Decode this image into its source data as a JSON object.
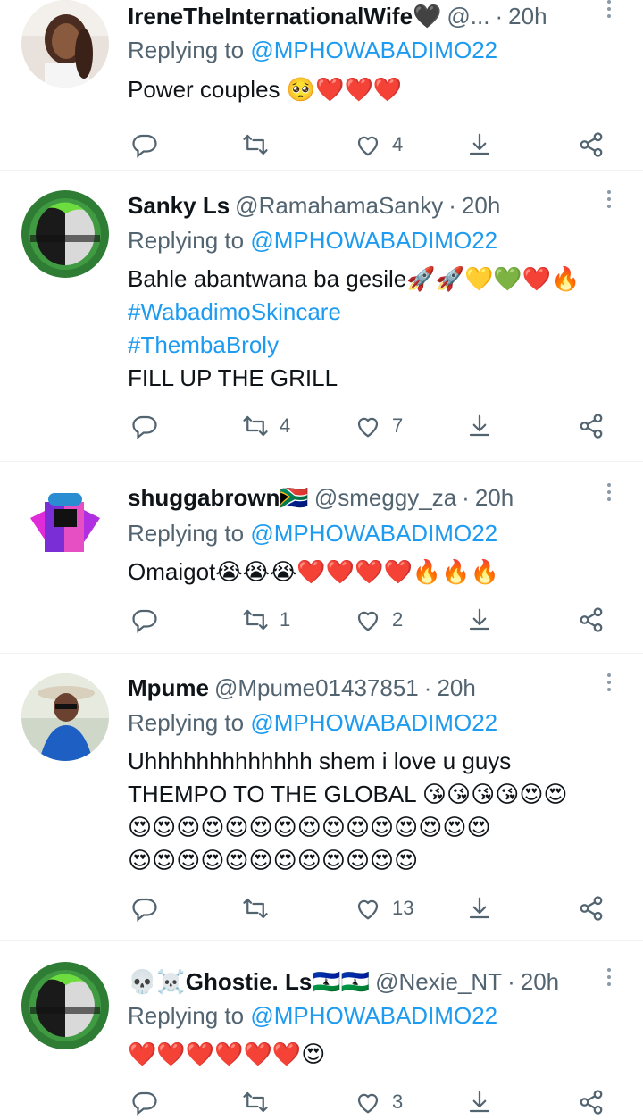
{
  "tweets": [
    {
      "name": "IreneTheInternationalWife🖤",
      "handle": "@...",
      "time": "20h",
      "reply_prefix": "Replying to",
      "reply_to": "@MPHOWABADIMO22",
      "lines": [
        "Power couples 🥺❤️❤️❤️"
      ],
      "stats": {
        "reply": "",
        "retweet": "",
        "like": "4"
      }
    },
    {
      "name": "Sanky Ls",
      "handle": "@RamahamaSanky",
      "time": "20h",
      "reply_prefix": "Replying to",
      "reply_to": "@MPHOWABADIMO22",
      "lines": [
        "Bahle abantwana ba gesile🚀🚀💛💚❤️🔥",
        "#WabadimoSkincare",
        "#ThembaBroly",
        "FILL UP THE GRILL"
      ],
      "stats": {
        "reply": "",
        "retweet": "4",
        "like": "7"
      }
    },
    {
      "name": "shuggabrown🇿🇦",
      "handle": "@smeggy_za",
      "time": "20h",
      "reply_prefix": "Replying to",
      "reply_to": "@MPHOWABADIMO22",
      "lines": [
        "Omaigot😭😭😭❤️❤️❤️❤️🔥🔥🔥"
      ],
      "stats": {
        "reply": "",
        "retweet": "1",
        "like": "2"
      }
    },
    {
      "name": "Mpume",
      "handle": "@Mpume01437851",
      "time": "20h",
      "reply_prefix": "Replying to",
      "reply_to": "@MPHOWABADIMO22",
      "lines": [
        "Uhhhhhhhhhhhhh shem i love u guys",
        "THEMPO TO THE GLOBAL 😘😘😘😘😍😍",
        "😍😍😍😍😍😍😍😍😍😍😍😍😍😍😍",
        "😍😍😍😍😍😍😍😍😍😍😍😍"
      ],
      "stats": {
        "reply": "",
        "retweet": "",
        "like": "13"
      }
    },
    {
      "name": "💀☠️Ghostie. Ls🇱🇸🇱🇸",
      "handle": "@Nexie_NT",
      "time": "20h",
      "reply_prefix": "Replying to",
      "reply_to": "@MPHOWABADIMO22",
      "lines": [
        "❤️❤️❤️❤️❤️❤️😍"
      ],
      "stats": {
        "reply": "",
        "retweet": "",
        "like": "3"
      }
    }
  ],
  "icons": [
    "reply-icon",
    "retweet-icon",
    "like-icon",
    "bookmark-download-icon",
    "share-icon",
    "more-options-icon"
  ],
  "colors": {
    "link": "#1d9bf0",
    "muted": "#536471",
    "text": "#0f1419",
    "divider": "#eff3f4"
  }
}
